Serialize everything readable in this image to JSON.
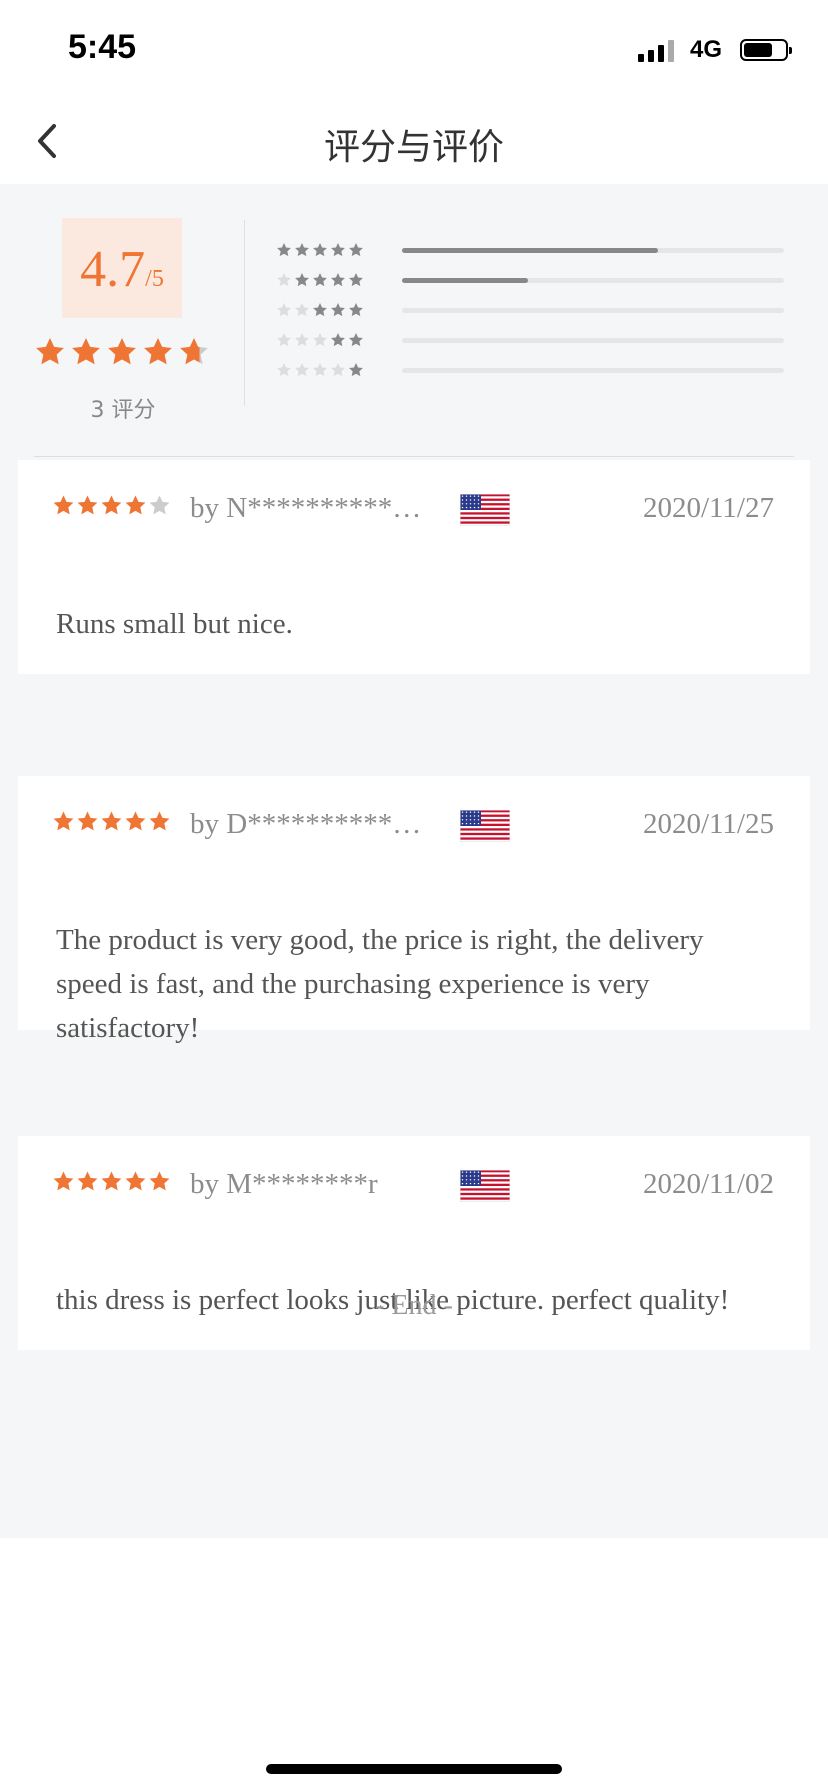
{
  "status": {
    "time": "5:45",
    "network": "4G"
  },
  "nav": {
    "title": "评分与评价"
  },
  "summary": {
    "score": "4.7",
    "score_max": "/5",
    "average_stars": 4.7,
    "rating_count_label": "3 评分",
    "distribution": [
      {
        "stars": 5,
        "fraction": 0.67
      },
      {
        "stars": 4,
        "fraction": 0.33
      },
      {
        "stars": 3,
        "fraction": 0
      },
      {
        "stars": 2,
        "fraction": 0
      },
      {
        "stars": 1,
        "fraction": 0
      }
    ]
  },
  "reviews": [
    {
      "rating": 4,
      "author": "by N**********…",
      "date": "2020/11/27",
      "country_flag": "us-flag-icon",
      "text": "Runs small but nice."
    },
    {
      "rating": 5,
      "author": "by D**********…",
      "date": "2020/11/25",
      "country_flag": "us-flag-icon",
      "text": "The product is very good, the price is right, the delivery speed is fast, and the purchasing experience is very satisfactory!"
    },
    {
      "rating": 5,
      "author": "by M********r",
      "date": "2020/11/02",
      "country_flag": "us-flag-icon",
      "text": "this dress is perfect looks just like picture. perfect quality!"
    }
  ],
  "footer": {
    "end_label": "- End -"
  },
  "colors": {
    "accent": "#ee7533",
    "star_empty": "#cccccc",
    "bar_fill": "#888888",
    "background": "#f5f6f8"
  }
}
